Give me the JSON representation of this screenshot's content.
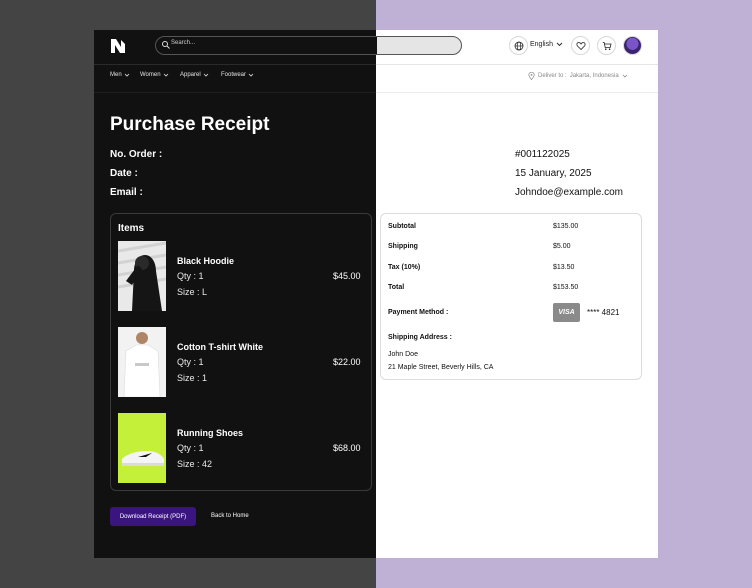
{
  "header": {
    "logo_letter": "N",
    "search_placeholder": "Search...",
    "language": "English",
    "deliver_label": "Deliver to :",
    "deliver_location": "Jakarta, Indonesia"
  },
  "nav": {
    "items": [
      {
        "label": "Men"
      },
      {
        "label": "Women"
      },
      {
        "label": "Apparel"
      },
      {
        "label": "Footwear"
      }
    ]
  },
  "receipt": {
    "title": "Purchase Receipt",
    "order_label": "No. Order :",
    "order_value": "#001122025",
    "date_label": "Date :",
    "date_value": "15 January, 2025",
    "email_label": "Email :",
    "email_value": "Johndoe@example.com"
  },
  "items_section": {
    "heading": "Items",
    "items": [
      {
        "name": "Black Hoodie",
        "qty": "Qty : 1",
        "size": "Size : L",
        "price": "$45.00"
      },
      {
        "name": "Cotton T-shirt White",
        "qty": "Qty : 1",
        "size": "Size : 1",
        "price": "$22.00"
      },
      {
        "name": "Running Shoes",
        "qty": "Qty : 1",
        "size": "Size : 42",
        "price": "$68.00"
      }
    ]
  },
  "summary": {
    "subtotal_label": "Subtotal",
    "subtotal_value": "$135.00",
    "shipping_label": "Shipping",
    "shipping_value": "$5.00",
    "tax_label": "Tax (10%)",
    "tax_value": "$13.50",
    "total_label": "Total",
    "total_value": "$153.50",
    "payment_label": "Payment Method :",
    "card_brand": "VISA",
    "card_number": "**** 4821",
    "address_label": "Shipping Address :",
    "address_name": "John Doe",
    "address_line": "21 Maple Street, Beverly Hills, CA"
  },
  "actions": {
    "download": "Download Receipt (PDF)",
    "back": "Back to Home"
  },
  "colors": {
    "accent": "#3a1580",
    "dark_panel": "#111111",
    "bg_left": "#444444",
    "bg_right": "#bfb0d6"
  }
}
